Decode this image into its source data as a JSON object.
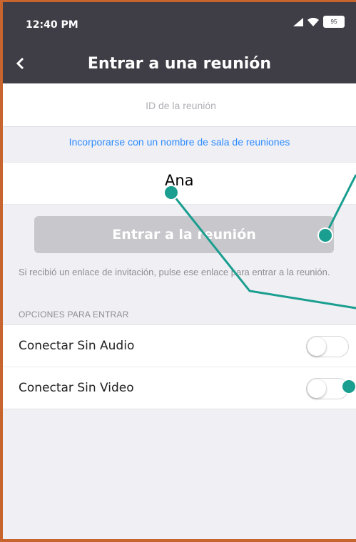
{
  "status": {
    "time": "12:40 PM",
    "signal_icon": "signal-icon",
    "wifi_icon": "wifi-icon",
    "battery_level": "95"
  },
  "navbar": {
    "back_icon": "chevron-left-icon",
    "title": "Entrar a una reunión"
  },
  "meeting_id": {
    "value": "",
    "placeholder": "ID de la reunión"
  },
  "join_with_room_link": "Incorporarse con un nombre de sala de reuniones",
  "display_name": {
    "value": "Ana"
  },
  "join_button": {
    "label": "Entrar a la reunión",
    "enabled": false
  },
  "hint_text": "Si recibió un enlace de invitación, pulse ese enlace para entrar a la reunión.",
  "options": {
    "section_label": "OPCIONES PARA ENTRAR",
    "items": [
      {
        "label": "Conectar Sin Audio",
        "on": false
      },
      {
        "label": "Conectar Sin Video",
        "on": false
      }
    ]
  },
  "colors": {
    "header_bg": "#3f3e47",
    "link_blue": "#2d8cff",
    "annotation_teal": "#1a9e8f",
    "frame_orange": "#c8642e",
    "button_disabled": "#c8c8cc"
  }
}
